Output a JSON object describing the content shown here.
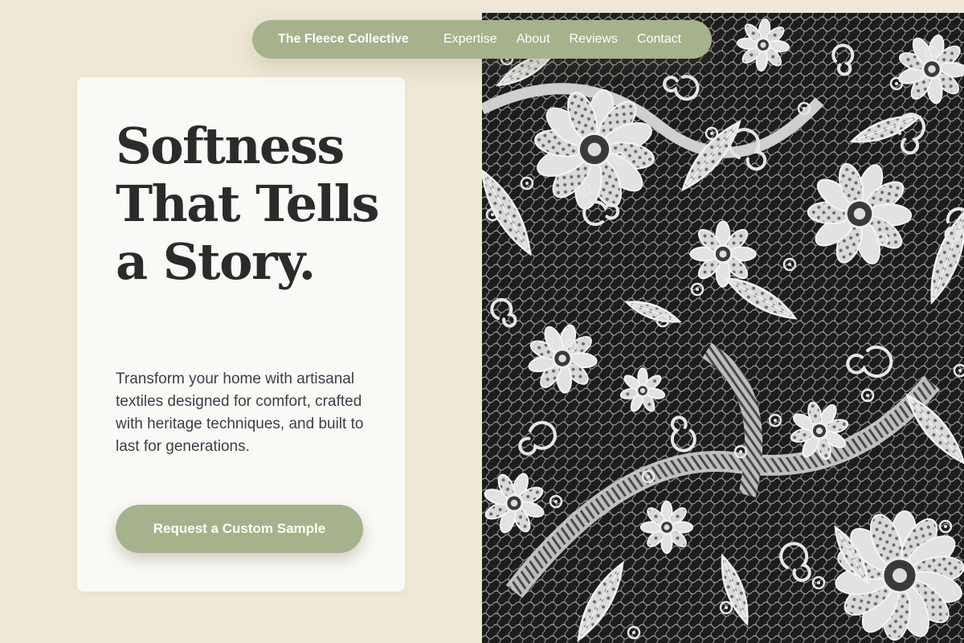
{
  "nav": {
    "brand": "The Fleece Collective",
    "links": [
      "Expertise",
      "About",
      "Reviews",
      "Contact"
    ]
  },
  "hero": {
    "headline": "Softness That Tells a Story.",
    "lead": "Transform your home with artisanal textiles designed for comfort, crafted with heritage techniques, and built to last for generations.",
    "cta_label": "Request a Custom Sample"
  },
  "image": {
    "subject": "lace-fabric"
  },
  "colors": {
    "background": "#efe8d6",
    "accent": "#a6b28b",
    "card": "#faf9f6",
    "headline": "#2b2b2b",
    "body_text": "#3b3f47"
  }
}
